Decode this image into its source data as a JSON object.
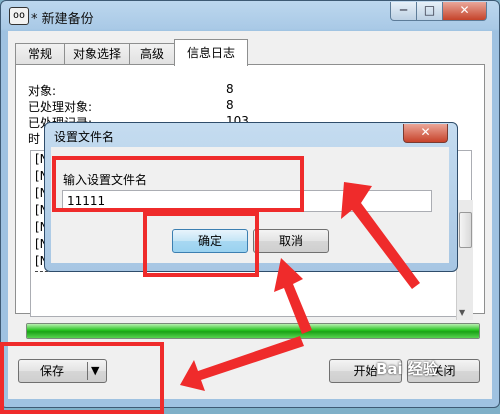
{
  "window": {
    "title": "* 新建备份",
    "icon": "oo",
    "min_glyph": "─",
    "max_glyph": "□",
    "close_glyph": "✕"
  },
  "tabs": [
    {
      "label": "常规",
      "active": false
    },
    {
      "label": "对象选择",
      "active": false
    },
    {
      "label": "高级",
      "active": false
    },
    {
      "label": "信息日志",
      "active": true
    }
  ],
  "stats": [
    {
      "label": "对象:",
      "value": "8"
    },
    {
      "label": "已处理对象:",
      "value": "8"
    },
    {
      "label": "已处理记录:",
      "value": "103"
    },
    {
      "label": "时",
      "value": ""
    }
  ],
  "log_lines": [
    "[N",
    "[N",
    "[N",
    "[N",
    "[N",
    "[N",
    "[N"
  ],
  "progress": {
    "fraction": 1.0,
    "color": "#25c21f"
  },
  "buttons": {
    "save": "保存",
    "save_arrow": "▼",
    "start": "开始",
    "close": "关闭"
  },
  "dialog": {
    "title": "设置文件名",
    "close_glyph": "✕",
    "prompt": "输入设置文件名",
    "input_value": "11111",
    "ok": "确定",
    "cancel": "取消"
  },
  "watermark": "Bai 经验",
  "annotation_color": "#ef2b2b"
}
